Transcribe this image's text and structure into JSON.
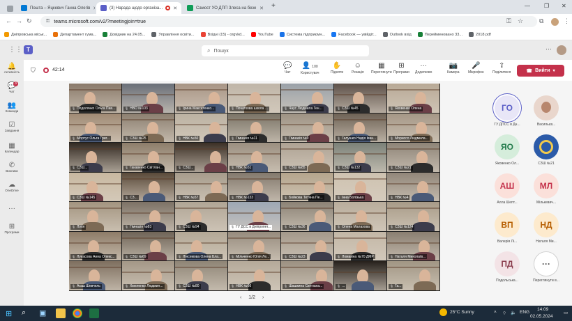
{
  "browser": {
    "tabs": [
      {
        "title": "Пошта – Яцкевич Ганна Олегів",
        "active": false,
        "color": "#0078d4"
      },
      {
        "title": "(3) Нарада щодо організа...",
        "active": true,
        "color": "#5b5fc7"
      },
      {
        "title": "Самост УО ДПП Злеса на безе",
        "active": false,
        "color": "#0f9d58"
      }
    ],
    "url": "teams.microsoft.com/v2/?meetingjoin=true",
    "bookmarks": [
      {
        "label": "Дніпровська міськ...",
        "color": "#f29900"
      },
      {
        "label": "Департамент гума...",
        "color": "#e8710a"
      },
      {
        "label": "Довідник на 24.05...",
        "color": "#188038"
      },
      {
        "label": "Управління освіти...",
        "color": "#5f6368"
      },
      {
        "label": "Вхідні (15) - orgvkd...",
        "color": "#ea4335"
      },
      {
        "label": "YouTube",
        "color": "#ff0000"
      },
      {
        "label": "Система підприємн...",
        "color": "#1a73e8"
      },
      {
        "label": "Facebook — увійдіт...",
        "color": "#1877f2"
      },
      {
        "label": "Outlook вхід",
        "color": "#5f6368"
      },
      {
        "label": "Перейменовано 33...",
        "color": "#188038"
      },
      {
        "label": "2018 pdf",
        "color": "#5f6368"
      }
    ]
  },
  "teams": {
    "search_placeholder": "Пошук",
    "rail": [
      {
        "label": "Активність",
        "icon": "bell-icon",
        "glyph": "🔔"
      },
      {
        "label": "Чат",
        "icon": "chat-icon",
        "glyph": "💬",
        "badge": "3"
      },
      {
        "label": "Команди",
        "icon": "teams-icon",
        "glyph": "👥"
      },
      {
        "label": "Завдання",
        "icon": "tasks-icon",
        "glyph": "☑"
      },
      {
        "label": "Календар",
        "icon": "calendar-icon",
        "glyph": "▦"
      },
      {
        "label": "Виклики",
        "icon": "phone-icon",
        "glyph": "✆"
      },
      {
        "label": "OneDrive",
        "icon": "cloud-icon",
        "glyph": "☁"
      },
      {
        "label": "",
        "icon": "more-icon",
        "glyph": "···"
      },
      {
        "label": "Програми",
        "icon": "apps-icon",
        "glyph": "⊞"
      }
    ],
    "timer": "42:14",
    "toolbar": [
      {
        "label": "Чат",
        "icon": "chat-icon",
        "glyph": "💬"
      },
      {
        "label": "Користувач",
        "icon": "people-icon",
        "glyph": "👤",
        "count": "100"
      },
      {
        "label": "Підняти",
        "icon": "hand-icon",
        "glyph": "✋"
      },
      {
        "label": "Реакція",
        "icon": "emoji-icon",
        "glyph": "☺"
      },
      {
        "label": "Переглянути",
        "icon": "view-icon",
        "glyph": "▦"
      },
      {
        "label": "Програми",
        "icon": "apps-icon",
        "glyph": "⊞"
      },
      {
        "label": "Додатково",
        "icon": "more-icon",
        "glyph": "···"
      },
      {
        "label": "Камера",
        "icon": "camera-off-icon",
        "glyph": "📷"
      },
      {
        "label": "Мікрофон",
        "icon": "mic-off-icon",
        "glyph": "🎤"
      },
      {
        "label": "Поділитися",
        "icon": "share-icon",
        "glyph": "⇪"
      }
    ],
    "leave_label": "Вийти",
    "pager": "1/2",
    "tiles": [
      {
        "label": "Подолянко Ольга Пав...",
        "bg": "#8a7a6a"
      },
      {
        "label": "НВО №103",
        "bg": "#6a6f78"
      },
      {
        "label": "Ірина Максетенко...",
        "bg": "#a89585"
      },
      {
        "label": "Початкова школа ...",
        "bg": "#c0b6a8"
      },
      {
        "label": "Чаус Людмила Ген...",
        "bg": "#9aa1a8"
      },
      {
        "label": "СЗШ №45",
        "bg": "#5d5048"
      },
      {
        "label": "Яковенко Олена",
        "bg": "#b8a996"
      },
      {
        "label": "Мортус Ольга Григ...",
        "bg": "#a08a74"
      },
      {
        "label": "СЗШ №25",
        "bg": "#8c7f70"
      },
      {
        "label": "НВК №50",
        "bg": "#bcb2a2"
      },
      {
        "label": "Гімназія №11",
        "bg": "#7a7366"
      },
      {
        "label": "Гімназія №9",
        "bg": "#9d9283"
      },
      {
        "label": "Галушко Надія Іван...",
        "bg": "#6e6255"
      },
      {
        "label": "Мориссо Людмила...",
        "bg": "#a59786"
      },
      {
        "label": "СЗШ...",
        "bg": "#332a22"
      },
      {
        "label": "Гакавенко Світлан...",
        "bg": "#8d7d6a"
      },
      {
        "label": "СЗШ...",
        "bg": "#3c3026"
      },
      {
        "label": "НВК №51",
        "bg": "#9b8f80"
      },
      {
        "label": "СЗШ №85",
        "bg": "#aea293"
      },
      {
        "label": "СЗШ №132",
        "bg": "#7b8178"
      },
      {
        "label": "СЗШ №21",
        "bg": "#8e8477"
      },
      {
        "label": "СЗШ №145",
        "bg": "#c8b8a0"
      },
      {
        "label": "СЗ...",
        "bg": "#5a4a3a"
      },
      {
        "label": "НВК №57",
        "bg": "#a69b8b"
      },
      {
        "label": "НВК №133",
        "bg": "#83796d"
      },
      {
        "label": "Бойкова Тетяна Пе...",
        "bg": "#b4a48c"
      },
      {
        "label": "Інна Болізька",
        "bg": "#cec2b0"
      },
      {
        "label": "НВК №4",
        "bg": "#918679"
      },
      {
        "label": "Лілія",
        "bg": "#a39480"
      },
      {
        "label": "Гімназія №83",
        "bg": "#7d7266"
      },
      {
        "label": "СЗШ №94",
        "bg": "#b0a595"
      },
      {
        "label": "ГУ ДСС в Дніпропет...",
        "bg": "#9da7b4",
        "highlight": true
      },
      {
        "label": "СЗШ №36",
        "bg": "#8c8376"
      },
      {
        "label": "Олена Малахова",
        "bg": "#b9ad9c"
      },
      {
        "label": "СЗШ №124",
        "bg": "#a89b88"
      },
      {
        "label": "Лукасова Анна Олекс...",
        "bg": "#8e7c68"
      },
      {
        "label": "СЗШ №69",
        "bg": "#6f6457"
      },
      {
        "label": "Лінсемова Олена Бла...",
        "bg": "#b3a896"
      },
      {
        "label": "Мільченко Юлія Ле...",
        "bg": "#978c7e"
      },
      {
        "label": "СЗШ №23",
        "bg": "#a3988a"
      },
      {
        "label": "Ломакіна №70 ДМР",
        "bg": "#c3b7a6"
      },
      {
        "label": "Наталя Миколаїв...",
        "bg": "#8a7f71"
      },
      {
        "label": "Агаш Шевчель",
        "bg": "#7e6f5f"
      },
      {
        "label": "Хмеленко Людмил...",
        "bg": "#a49887"
      },
      {
        "label": "СЗШ №80",
        "bg": "#8f8576"
      },
      {
        "label": "НВК №66",
        "bg": "#b5aa9a"
      },
      {
        "label": "Шашкина Світлана...",
        "bg": "#9c9182"
      },
      {
        "label": "...",
        "bg": "#27211c"
      },
      {
        "label": "Га...",
        "bg": "#a19684"
      }
    ],
    "participants": [
      {
        "initials": "ГО",
        "name": "ГУ ДПСС в Дн...",
        "bg": "#e8e6f7",
        "fg": "#5b5fc7",
        "ring": true
      },
      {
        "initials": "",
        "name": "Васильєв...",
        "bg": "#e9d6cc",
        "fg": "#7a4a3a",
        "photo": true
      },
      {
        "initials": "ЯО",
        "name": "Яковенко Ол...",
        "bg": "#d5eddb",
        "fg": "#237b4b"
      },
      {
        "initials": "",
        "name": "СЗШ №21",
        "bg": "#2b5aa8",
        "fg": "#f2c94c",
        "emblem": true
      },
      {
        "initials": "АШ",
        "name": "Алла Шепт...",
        "bg": "#fbe0da",
        "fg": "#c4314b"
      },
      {
        "initials": "МЛ",
        "name": "Мількевич...",
        "bg": "#fbe0da",
        "fg": "#c4314b"
      },
      {
        "initials": "ВП",
        "name": "Валерія Лі...",
        "bg": "#fdeacd",
        "fg": "#b65d00"
      },
      {
        "initials": "НД",
        "name": "Наталя Ми...",
        "bg": "#fdeacd",
        "fg": "#b65d00"
      },
      {
        "initials": "ПД",
        "name": "Подольська...",
        "bg": "#f3e3e6",
        "fg": "#8a3c4c"
      },
      {
        "initials": "···",
        "name": "Переглянути в...",
        "bg": "#ffffff",
        "fg": "#424242",
        "more": true
      }
    ]
  },
  "taskbar": {
    "weather": "25°C  Sunny",
    "lang": "ENG",
    "time": "14:09",
    "date": "02.05.2024"
  }
}
